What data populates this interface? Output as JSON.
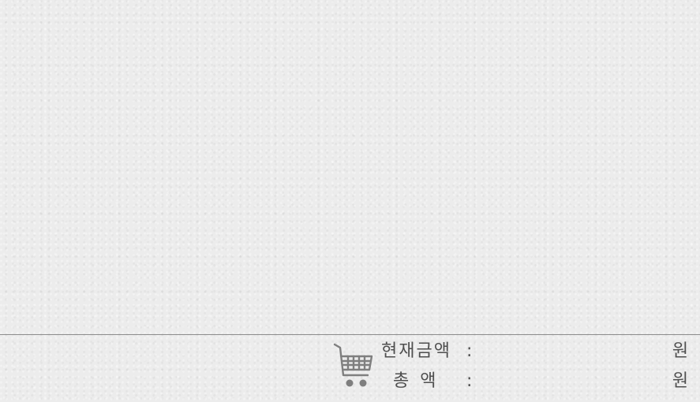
{
  "summary": {
    "current_amount_label": "현재금액",
    "total_amount_label": "총액",
    "colon": ":",
    "current_amount_value": "",
    "total_amount_value": "",
    "currency_unit": "원"
  },
  "icons": {
    "cart": "shopping-cart-icon"
  },
  "colors": {
    "text": "#4f4f4f",
    "divider": "#8e8e8e",
    "background": "#ececec"
  }
}
